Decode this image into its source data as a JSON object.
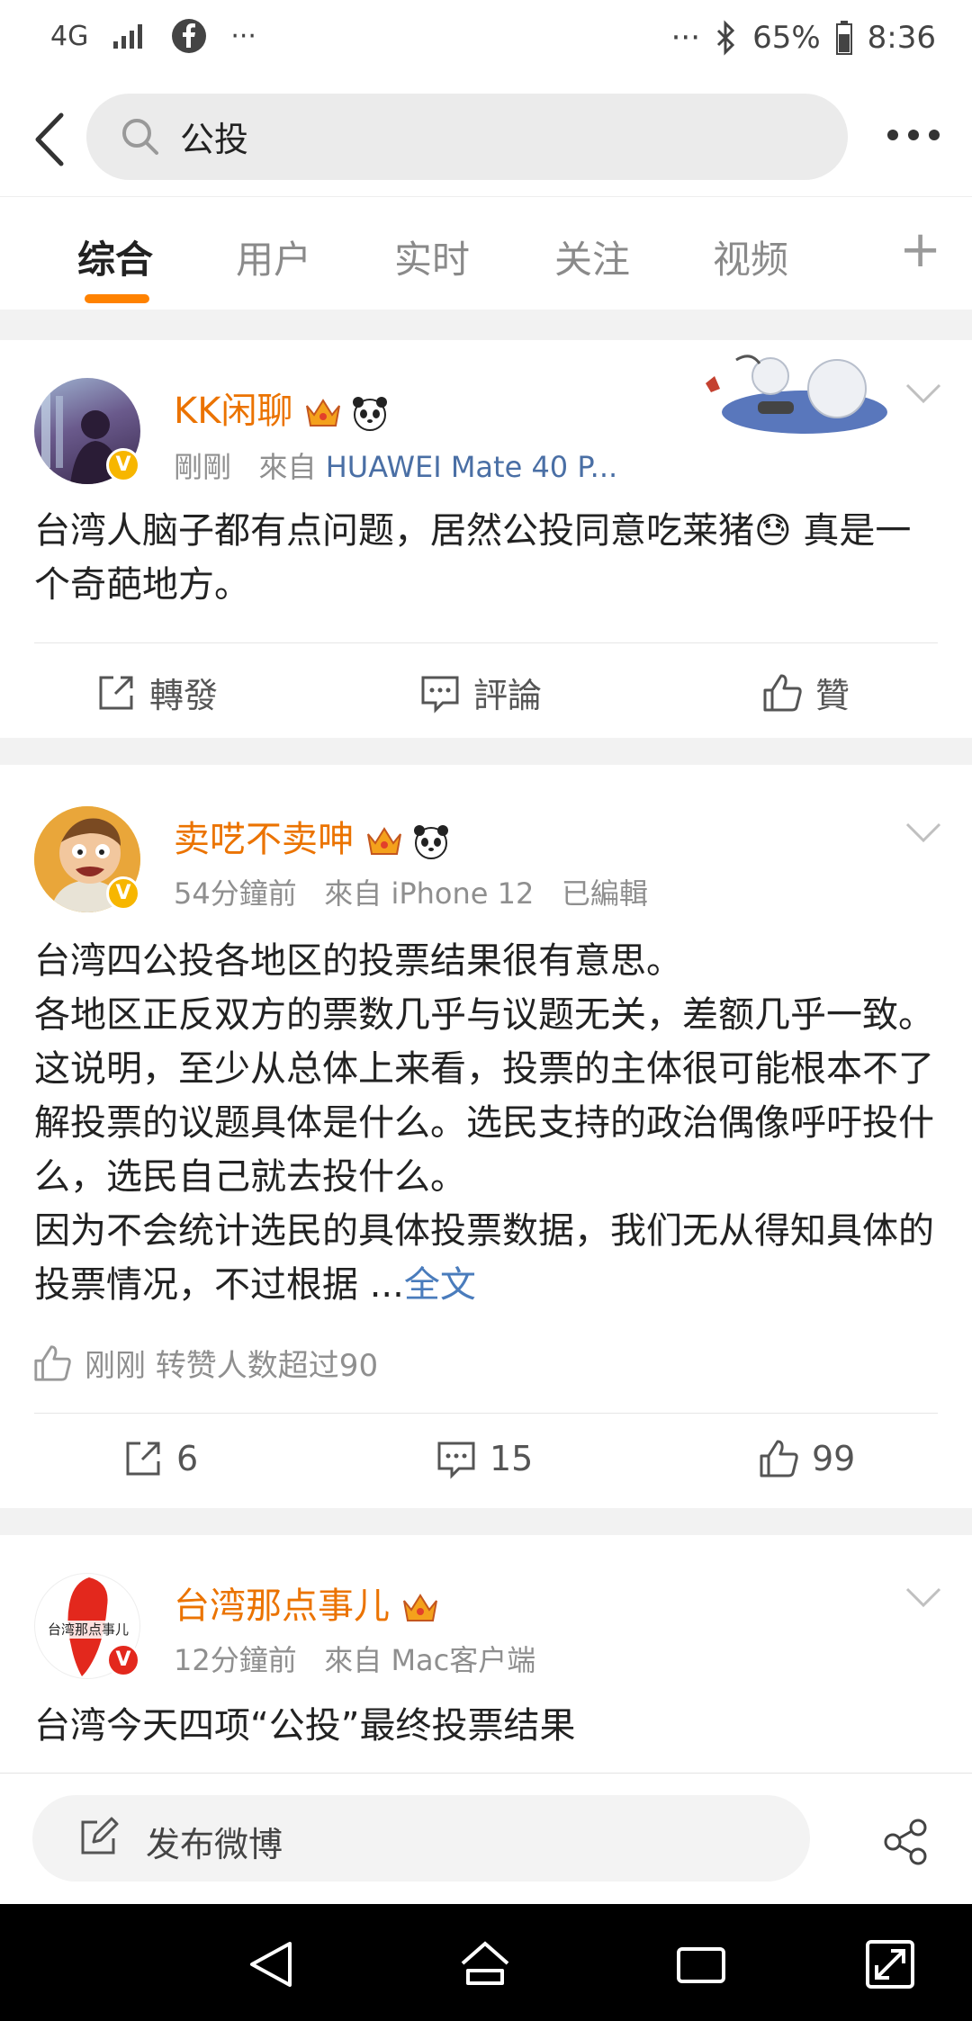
{
  "status_bar": {
    "network": "4G",
    "dots": "···",
    "right_dots": "···",
    "battery": "65%",
    "time": "8:36"
  },
  "search": {
    "query": "公投"
  },
  "tabs": [
    {
      "label": "综合"
    },
    {
      "label": "用户"
    },
    {
      "label": "实时"
    },
    {
      "label": "关注"
    },
    {
      "label": "视频"
    }
  ],
  "posts": [
    {
      "username": "KK闲聊",
      "time": "剛剛",
      "source_prefix": "來自",
      "source": "HUAWEI Mate 40 P...",
      "text": "台湾人脑子都有点问题，居然公投同意吃莱猪😓 真是一个奇葩地方。",
      "repost_label": "轉發",
      "comment_label": "評論",
      "like_label": "贊"
    },
    {
      "username": "卖呓不卖呻",
      "time": "54分鐘前",
      "source_prefix": "來自",
      "source": "iPhone 12",
      "edited": "已編輯",
      "text": "台湾四公投各地区的投票结果很有意思。\n各地区正反双方的票数几乎与议题无关，差额几乎一致。这说明，至少从总体上来看，投票的主体很可能根本不了解投票的议题具体是什么。选民支持的政治偶像呼吁投什么，选民自己就去投什么。\n因为不会统计选民的具体投票数据，我们无从得知具体的投票情况，不过根据 ...",
      "full_text_link": "全文",
      "like_note": "刚刚 转赞人数超过90",
      "reposts": "6",
      "comments": "15",
      "likes": "99"
    },
    {
      "username": "台湾那点事儿",
      "time": "12分鐘前",
      "source_prefix": "來自",
      "source": "Mac客户端",
      "text": "台湾今天四项“公投”最终投票结果",
      "avatar_text": "台湾那点事儿"
    }
  ],
  "compose": {
    "label": "发布微博"
  },
  "colors": {
    "brand_orange": "#ff8200",
    "username": "#eb7300",
    "link": "#4a7cbc"
  }
}
